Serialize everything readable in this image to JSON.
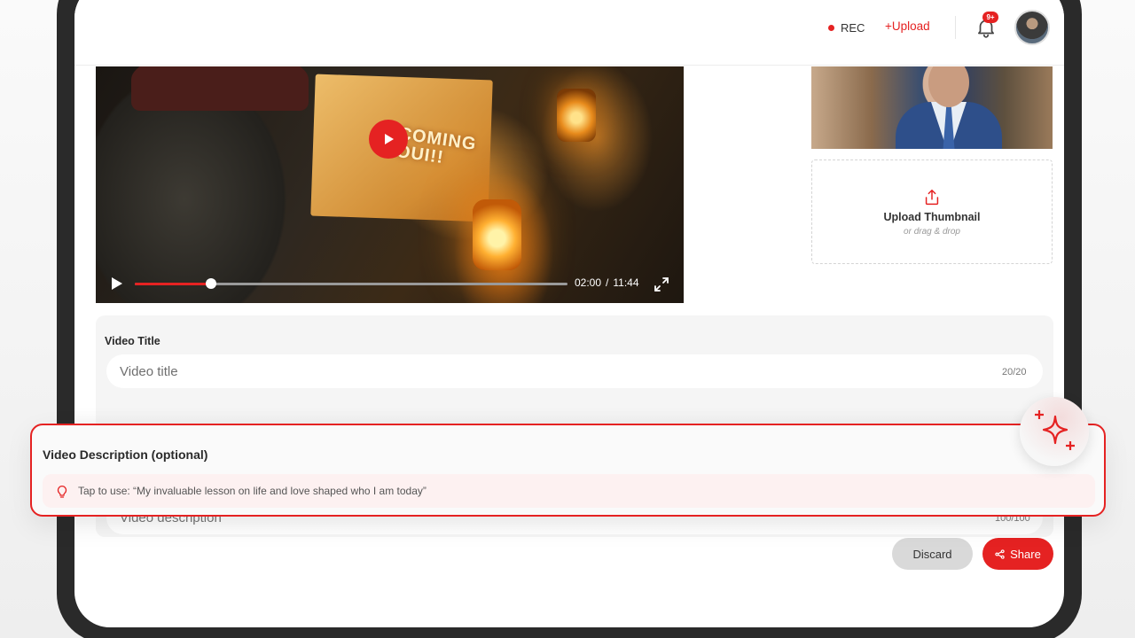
{
  "header": {
    "rec_label": "REC",
    "upload_label": "+Upload",
    "notification_badge": "9+"
  },
  "player": {
    "overlay_text_line1": "COMING",
    "overlay_text_line2": "OUI!!",
    "current_time": "02:00",
    "separator": "/",
    "duration": "11:44",
    "progress_fraction": 0.177
  },
  "thumbnail": {
    "upload_title": "Upload Thumbnail",
    "upload_sub": "or drag & drop"
  },
  "form": {
    "title_label": "Video Title",
    "title_placeholder": "Video title",
    "title_counter": "20/20",
    "description_label": "Video Description (optional)",
    "suggestion_text": "Tap to use: “My invaluable lesson on life and love shaped who I am today”",
    "description_placeholder": "Video description",
    "description_counter": "100/100"
  },
  "actions": {
    "discard_label": "Discard",
    "share_label": "Share"
  },
  "colors": {
    "accent": "#e52222",
    "discard_bg": "#d9d9d9"
  },
  "icons": {
    "bell": "bell-icon",
    "play": "play-icon",
    "fullscreen": "fullscreen-icon",
    "upload": "upload-icon",
    "bulb": "lightbulb-icon",
    "share": "share-icon",
    "sparkle": "sparkle-icon"
  }
}
